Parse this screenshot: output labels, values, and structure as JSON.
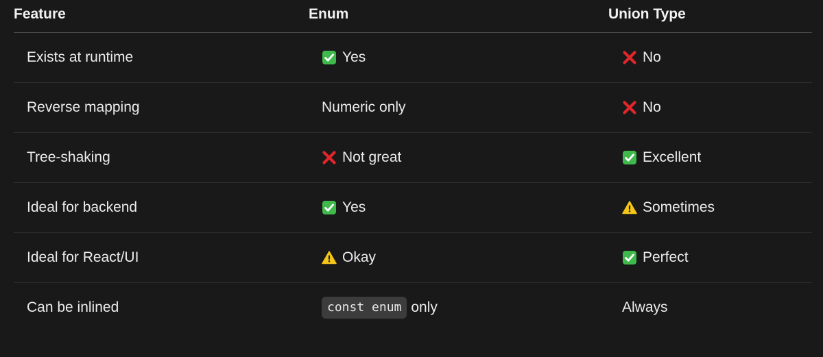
{
  "header": {
    "feature": "Feature",
    "enum": "Enum",
    "union": "Union Type"
  },
  "rows": [
    {
      "feature": "Exists at runtime",
      "enum": {
        "icon": "check-mark-icon",
        "text": "Yes"
      },
      "union": {
        "icon": "cross-mark-icon",
        "text": "No"
      }
    },
    {
      "feature": "Reverse mapping",
      "enum": {
        "icon": "",
        "text": "Numeric only"
      },
      "union": {
        "icon": "cross-mark-icon",
        "text": "No"
      }
    },
    {
      "feature": "Tree-shaking",
      "enum": {
        "icon": "cross-mark-icon",
        "text": "Not great"
      },
      "union": {
        "icon": "check-mark-icon",
        "text": "Excellent"
      }
    },
    {
      "feature": "Ideal for backend",
      "enum": {
        "icon": "check-mark-icon",
        "text": "Yes"
      },
      "union": {
        "icon": "warning-icon",
        "text": "Sometimes"
      }
    },
    {
      "feature": "Ideal for React/UI",
      "enum": {
        "icon": "warning-icon",
        "text": "Okay"
      },
      "union": {
        "icon": "check-mark-icon",
        "text": "Perfect"
      }
    },
    {
      "feature": "Can be inlined",
      "enum": {
        "code": "const enum",
        "text": "only"
      },
      "union": {
        "icon": "",
        "text": "Always"
      }
    }
  ],
  "colors": {
    "background": "#191919",
    "check_green": "#3fb94b",
    "cross_red": "#e0262a",
    "warning_yellow": "#f5c518",
    "code_background": "#3c3c3c"
  }
}
